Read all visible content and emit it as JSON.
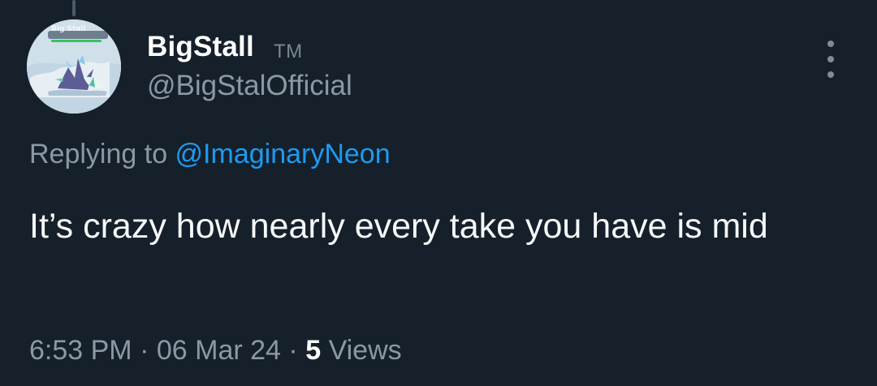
{
  "tweet": {
    "author": {
      "display_name": "BigStall",
      "badge": "TM",
      "handle": "@BigStalOfficial",
      "avatar_caption": "Big Stall"
    },
    "reply_prefix": "Replying to ",
    "reply_mention": "@ImaginaryNeon",
    "text": "It’s crazy how nearly every take you have is mid",
    "time": "6:53 PM",
    "date": "06 Mar 24",
    "views_count": "5",
    "views_label": "Views",
    "separator": "·"
  },
  "colors": {
    "background": "#15202b",
    "mention": "#1d9bf0",
    "secondary_text": "#8b98a5",
    "primary_text": "#f7f9f9"
  },
  "icons": {
    "more": "more-vertical-icon"
  }
}
